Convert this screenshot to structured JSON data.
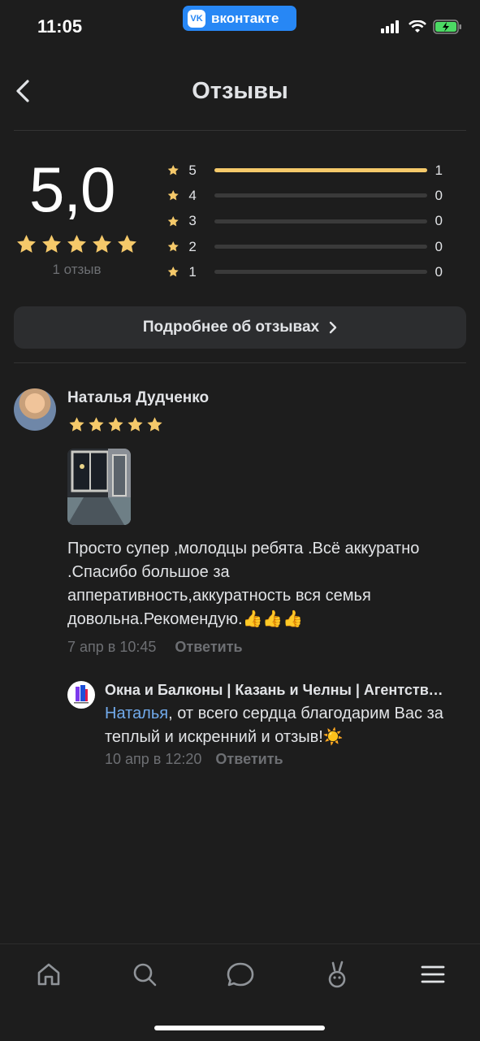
{
  "status_bar": {
    "time": "11:05",
    "app_pill": "вконтакте",
    "app_logo": "VK"
  },
  "header": {
    "title": "Отзывы"
  },
  "summary": {
    "score": "5,0",
    "stars": 5,
    "review_count": "1 отзыв",
    "distribution": [
      {
        "label": "5",
        "value": "1",
        "fraction": 1
      },
      {
        "label": "4",
        "value": "0",
        "fraction": 0
      },
      {
        "label": "3",
        "value": "0",
        "fraction": 0
      },
      {
        "label": "2",
        "value": "0",
        "fraction": 0
      },
      {
        "label": "1",
        "value": "0",
        "fraction": 0
      }
    ]
  },
  "more_button": {
    "label": "Подробнее об отзывах"
  },
  "review": {
    "author": "Наталья Дудченко",
    "stars": 5,
    "text": "Просто супер ,молодцы ребята .Всё аккуратно .Спасибо большое за апперативность,аккуратность вся семья довольна.Рекомендую.👍👍👍",
    "date": "7 апр в 10:45",
    "reply_label": "Ответить"
  },
  "company_reply": {
    "name": "Окна и Балконы | Казань и Челны | Агентство окон",
    "mention": "Наталья",
    "text": ", от всего сердца благодарим Вас за теплый и искренний и отзыв!☀️",
    "date": "10 апр в 12:20",
    "reply_label": "Ответить"
  },
  "tabs": [
    "home-icon",
    "search-icon",
    "messages-icon",
    "clips-icon",
    "menu-icon"
  ],
  "colors": {
    "accent_star": "#f5c96a",
    "link": "#71aaeb",
    "vk_blue": "#2787f5"
  }
}
